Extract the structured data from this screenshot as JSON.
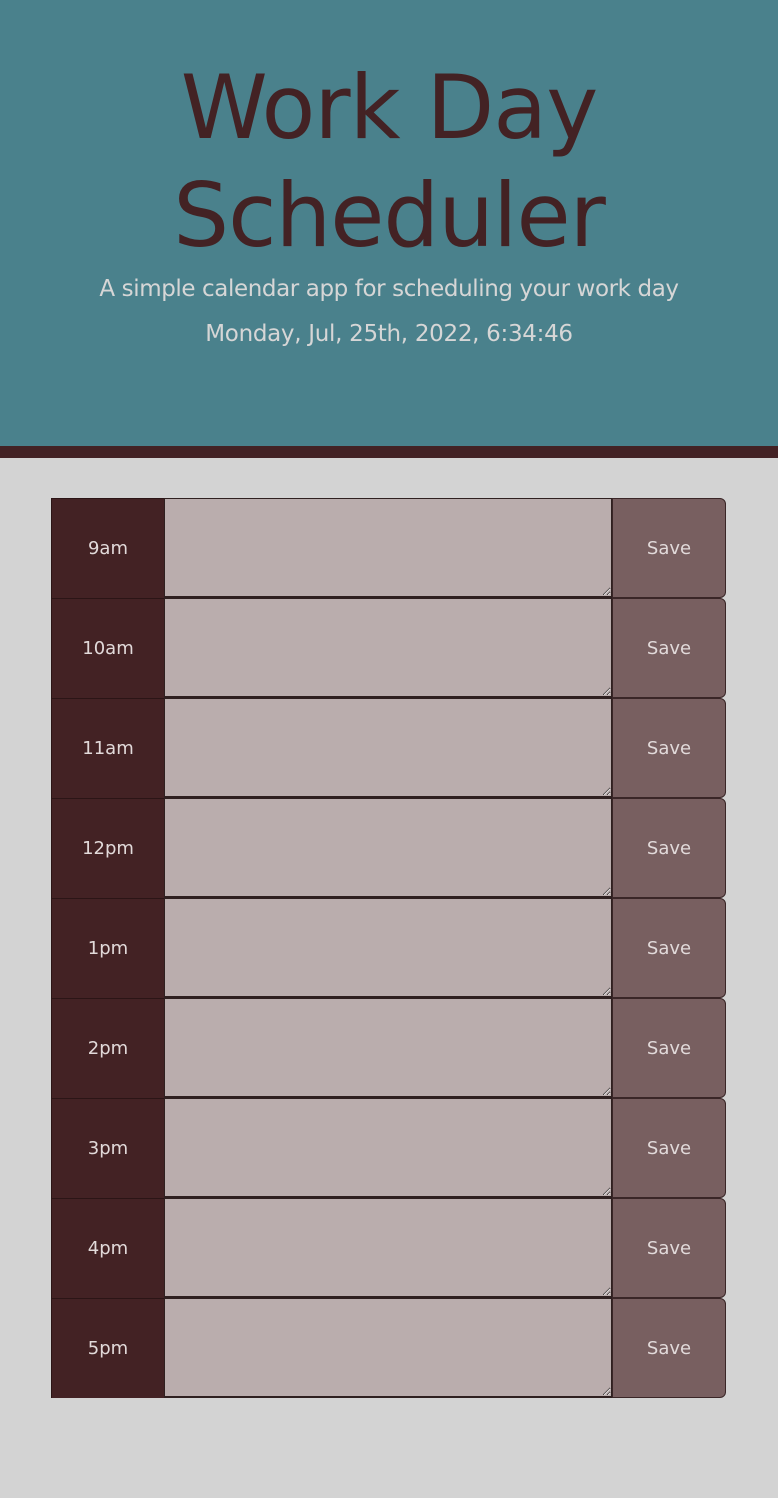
{
  "header": {
    "title": "Work Day Scheduler",
    "subtitle": "A simple calendar app for scheduling your work day",
    "current_day": "Monday, Jul, 25th, 2022, 6:34:46"
  },
  "time_blocks": [
    {
      "hour": "9am",
      "text": "",
      "save_label": "Save"
    },
    {
      "hour": "10am",
      "text": "",
      "save_label": "Save"
    },
    {
      "hour": "11am",
      "text": "",
      "save_label": "Save"
    },
    {
      "hour": "12pm",
      "text": "",
      "save_label": "Save"
    },
    {
      "hour": "1pm",
      "text": "",
      "save_label": "Save"
    },
    {
      "hour": "2pm",
      "text": "",
      "save_label": "Save"
    },
    {
      "hour": "3pm",
      "text": "",
      "save_label": "Save"
    },
    {
      "hour": "4pm",
      "text": "",
      "save_label": "Save"
    },
    {
      "hour": "5pm",
      "text": "",
      "save_label": "Save"
    }
  ],
  "colors": {
    "header_bg": "#4a818c",
    "header_border": "#432224",
    "title": "#432224",
    "page_bg": "#d3d3d3",
    "hour_bg": "#432224",
    "textarea_bg": "#baadad",
    "save_bg": "#785f60"
  }
}
